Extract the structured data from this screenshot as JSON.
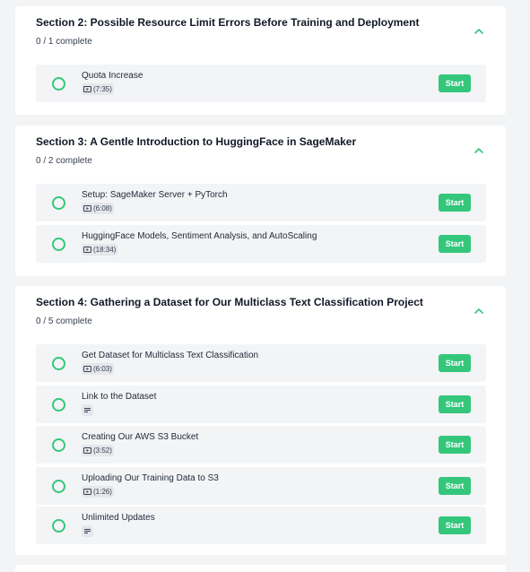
{
  "theme": {
    "accent": "#34c77b",
    "page_background": "#f3f4f6",
    "card_background": "#ffffff",
    "lesson_background": "#f3f4f6"
  },
  "sections": [
    {
      "title": "Section 2: Possible Resource Limit Errors Before Training and Deployment",
      "progress": "0 / 1 complete",
      "toggle_icon": "chevron-up-icon",
      "lessons": [
        {
          "title": "Quota Increase",
          "type": "video",
          "icon": "video-icon",
          "duration": "(7:35)",
          "action": "Start",
          "completed": false
        }
      ]
    },
    {
      "title": "Section 3: A Gentle Introduction to HuggingFace in SageMaker",
      "progress": "0 / 2 complete",
      "toggle_icon": "chevron-up-icon",
      "lessons": [
        {
          "title": "Setup: SageMaker Server + PyTorch",
          "type": "video",
          "icon": "video-icon",
          "duration": "(6:08)",
          "action": "Start",
          "completed": false
        },
        {
          "title": "HuggingFace Models, Sentiment Analysis, and AutoScaling",
          "type": "video",
          "icon": "video-icon",
          "duration": "(18:34)",
          "action": "Start",
          "completed": false
        }
      ]
    },
    {
      "title": "Section 4: Gathering a Dataset for Our Multiclass Text Classification Project",
      "progress": "0 / 5 complete",
      "toggle_icon": "chevron-up-icon",
      "lessons": [
        {
          "title": "Get Dataset for Multiclass Text Classification",
          "type": "video",
          "icon": "video-icon",
          "duration": "(6:03)",
          "action": "Start",
          "completed": false
        },
        {
          "title": "Link to the Dataset",
          "type": "text",
          "icon": "text-icon",
          "duration": "",
          "action": "Start",
          "completed": false
        },
        {
          "title": "Creating Our AWS S3 Bucket",
          "type": "video",
          "icon": "video-icon",
          "duration": "(3:52)",
          "action": "Start",
          "completed": false
        },
        {
          "title": "Uploading Our Training Data to S3",
          "type": "video",
          "icon": "video-icon",
          "duration": "(1:26)",
          "action": "Start",
          "completed": false
        },
        {
          "title": "Unlimited Updates",
          "type": "text",
          "icon": "text-icon",
          "duration": "",
          "action": "Start",
          "completed": false
        }
      ]
    }
  ]
}
